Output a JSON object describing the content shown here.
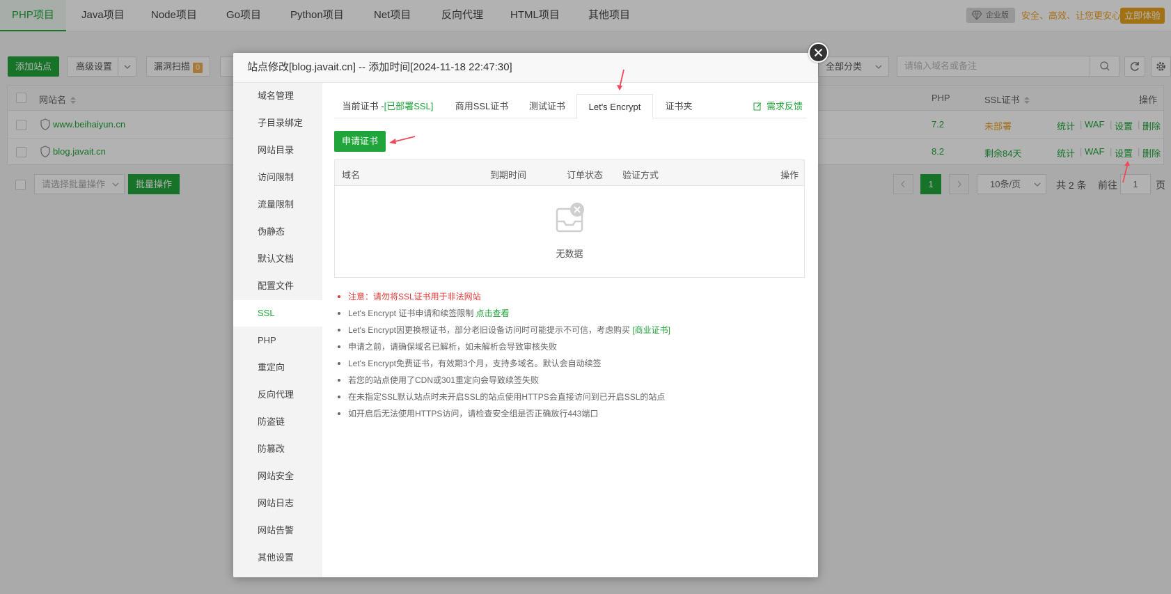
{
  "topnav": {
    "tabs": [
      "PHP项目",
      "Java项目",
      "Node项目",
      "Go项目",
      "Python项目",
      "Net项目",
      "反向代理",
      "HTML项目",
      "其他项目"
    ],
    "enterprise_badge": "企业版",
    "slogan": "安全、高效、让您更安心",
    "try_button": "立即体验"
  },
  "toolbar": {
    "add_site": "添加站点",
    "advanced": "高级设置",
    "vuln_scan": "漏洞扫描",
    "vuln_count": "0",
    "category": "全部分类",
    "search_placeholder": "请输入域名或备注"
  },
  "site_table": {
    "headers": {
      "name": "网站名",
      "php": "PHP",
      "ssl": "SSL证书",
      "ops": "操作"
    },
    "rows": [
      {
        "name": "www.beihaiyun.cn",
        "php": "7.2",
        "ssl": "未部署",
        "ops": [
          "统计",
          "WAF",
          "设置",
          "删除"
        ]
      },
      {
        "name": "blog.javait.cn",
        "php": "8.2",
        "ssl": "剩余84天",
        "ops": [
          "统计",
          "WAF",
          "设置",
          "删除"
        ]
      }
    ]
  },
  "footer": {
    "batch_select": "请选择批量操作",
    "batch_btn": "批量操作",
    "page": "1",
    "page_size": "10条/页",
    "total": "共 2 条",
    "goto_label": "前往",
    "goto_value": "1",
    "page_suffix": "页"
  },
  "modal": {
    "title": "站点修改[blog.javait.cn] -- 添加时间[2024-11-18 22:47:30]",
    "side_menu": [
      "域名管理",
      "子目录绑定",
      "网站目录",
      "访问限制",
      "流量限制",
      "伪静态",
      "默认文档",
      "配置文件",
      "SSL",
      "PHP",
      "重定向",
      "反向代理",
      "防盗链",
      "防篡改",
      "网站安全",
      "网站日志",
      "网站告警",
      "其他设置"
    ],
    "tabs": {
      "current_prefix": "当前证书 -",
      "current_status": "[已部署SSL]",
      "commercial": "商用SSL证书",
      "test": "测试证书",
      "letsencrypt": "Let's Encrypt",
      "folder": "证书夹",
      "feedback": "需求反馈"
    },
    "apply_button": "申请证书",
    "cert_table": {
      "headers": [
        "域名",
        "到期时间",
        "订单状态",
        "验证方式",
        "操作"
      ],
      "empty": "无数据"
    },
    "notes": {
      "n1": "注意：请勿将SSL证书用于非法网站",
      "n2_text": "Let's Encrypt 证书申请和续签限制",
      "n2_link": "点击查看",
      "n3_text": "Let's Encrypt因更换根证书，部分老旧设备访问时可能提示不可信，考虑购买",
      "n3_link": "[商业证书]",
      "n4": "申请之前，请确保域名已解析，如未解析会导致审核失败",
      "n5": "Let's Encrypt免费证书，有效期3个月，支持多域名。默认会自动续签",
      "n6": "若您的站点使用了CDN或301重定向会导致续签失败",
      "n7": "在未指定SSL默认站点时未开启SSL的站点使用HTTPS会直接访问到已开启SSL的站点",
      "n8": "如开启后无法使用HTTPS访问，请检查安全组是否正确放行443端口"
    }
  },
  "colors": {
    "accent": "#20a53a",
    "warning": "#f0a020",
    "danger": "#e53935"
  }
}
